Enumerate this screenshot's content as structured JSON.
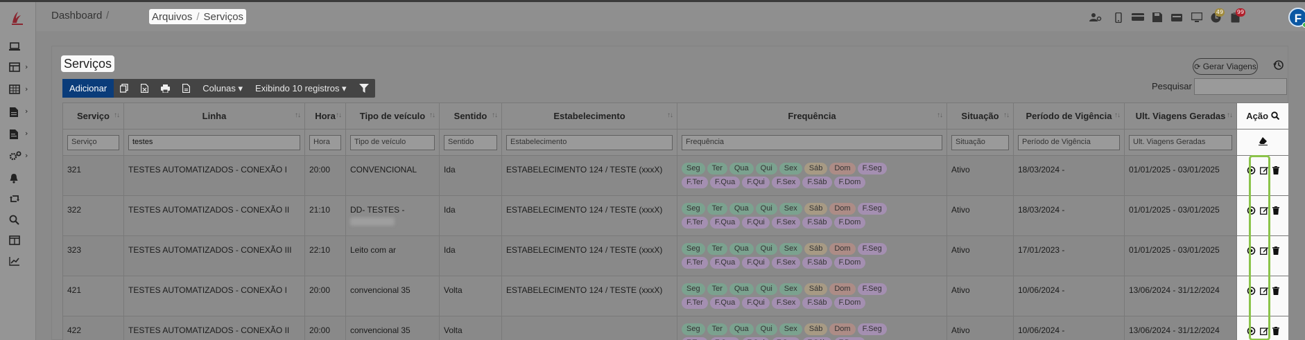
{
  "breadcrumb": {
    "dashboard": "Dashboard",
    "separator": "/",
    "arquivos": "Arquivos",
    "servicos": "Serviços"
  },
  "topbar": {
    "badges": {
      "bell": "49",
      "notifications": "99"
    },
    "avatar": "F"
  },
  "page": {
    "title": "Serviços",
    "gerar_viagens": "Gerar Viagens",
    "search_label": "Pesquisar"
  },
  "toolbar": {
    "add": "Adicionar",
    "columns": "Colunas ▾",
    "showing": "Exibindo 10 registros ▾"
  },
  "columns": [
    "Serviço",
    "Linha",
    "Hora",
    "Tipo de veículo",
    "Sentido",
    "Estabelecimento",
    "Frequência",
    "Situação",
    "Período de Vigência",
    "Ult. Viagens Geradas",
    "Ação"
  ],
  "filters": {
    "servico": "Serviço",
    "linha": "testes",
    "hora": "Hora",
    "tipo": "Tipo de veículo",
    "sentido": "Sentido",
    "estabelecimento": "Estabelecimento",
    "frequencia": "Frequência",
    "situacao": "Situação",
    "periodo": "Período de Vigência",
    "ult": "Ult. Viagens Geradas"
  },
  "days": [
    "Seg",
    "Ter",
    "Qua",
    "Qui",
    "Sex",
    "Sáb",
    "Dom"
  ],
  "fdays": [
    "F.Seg",
    "F.Ter",
    "F.Qua",
    "F.Qui",
    "F.Sex",
    "F.Sáb",
    "F.Dom"
  ],
  "rows": [
    {
      "servico": "321",
      "linha": "TESTES AUTOMATIZADOS - CONEXÃO I",
      "hora": "20:00",
      "tipo": "CONVENCIONAL",
      "sentido": "Ida",
      "estab": "ESTABELECIMENTO 124 / TESTE (xxxX)",
      "situacao": "Ativo",
      "periodo": "18/03/2024 -",
      "ult": "01/01/2025 - 03/01/2025"
    },
    {
      "servico": "322",
      "linha": "TESTES AUTOMATIZADOS - CONEXÃO II",
      "hora": "21:10",
      "tipo": "DD- TESTES -",
      "sentido": "Ida",
      "estab": "ESTABELECIMENTO 124 / TESTE (xxxX)",
      "situacao": "Ativo",
      "periodo": "18/03/2024 -",
      "ult": "01/01/2025 - 03/01/2025"
    },
    {
      "servico": "323",
      "linha": "TESTES AUTOMATIZADOS - CONEXÃO III",
      "hora": "22:10",
      "tipo": "Leito com ar",
      "sentido": "Ida",
      "estab": "ESTABELECIMENTO 124 / TESTE (xxxX)",
      "situacao": "Ativo",
      "periodo": "17/01/2023 -",
      "ult": "01/01/2025 - 03/01/2025"
    },
    {
      "servico": "421",
      "linha": "TESTES AUTOMATIZADOS - CONEXÃO I",
      "hora": "20:00",
      "tipo": "convencional 35",
      "sentido": "Volta",
      "estab": "ESTABELECIMENTO 124 / TESTE (xxxX)",
      "situacao": "Ativo",
      "periodo": "10/06/2024 -",
      "ult": "13/06/2024 - 31/12/2024"
    },
    {
      "servico": "422",
      "linha": "TESTES AUTOMATIZADOS - CONEXÃO II",
      "hora": "20:00",
      "tipo": "convencional 35",
      "sentido": "Volta",
      "estab": "",
      "situacao": "Ativo",
      "periodo": "10/06/2024 -",
      "ult": "13/06/2024 - 31/12/2024"
    }
  ]
}
